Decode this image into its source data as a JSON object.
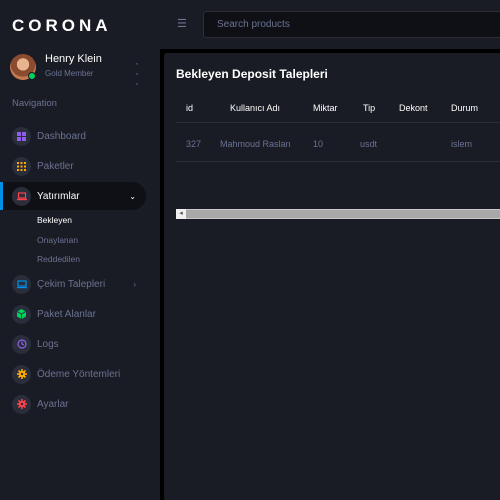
{
  "brand": "CORONA",
  "profile": {
    "name": "Henry Klein",
    "role": "Gold Member"
  },
  "nav_title": "Navigation",
  "nav": [
    {
      "label": "Dashboard",
      "icon": "dashboard-icon",
      "color": "#8f5fe8"
    },
    {
      "label": "Paketler",
      "icon": "grid-icon",
      "color": "#ffab00"
    },
    {
      "label": "Yatırımlar",
      "icon": "laptop-icon",
      "color": "#fc424a",
      "active": true
    },
    {
      "label": "Çekim Talepleri",
      "icon": "monitor-icon",
      "color": "#0090e7"
    },
    {
      "label": "Paket Alanlar",
      "icon": "cube-icon",
      "color": "#00d25b"
    },
    {
      "label": "Logs",
      "icon": "clock-icon",
      "color": "#8f5fe8"
    },
    {
      "label": "Ödeme Yöntemleri",
      "icon": "cog-icon",
      "color": "#ffab00"
    },
    {
      "label": "Ayarlar",
      "icon": "gear-icon",
      "color": "#fc424a"
    }
  ],
  "submenu": [
    "Bekleyen",
    "Onaylanan",
    "Reddedilen"
  ],
  "search": {
    "placeholder": "Search products"
  },
  "page_title": "Bekleyen Deposit Talepleri",
  "table": {
    "headers": [
      "id",
      "Kullanıcı Adı",
      "Miktar",
      "Tip",
      "Dekont",
      "Durum"
    ],
    "rows": [
      [
        "327",
        "Mahmoud Raslan",
        "10",
        "usdt",
        "",
        "islem"
      ]
    ]
  }
}
